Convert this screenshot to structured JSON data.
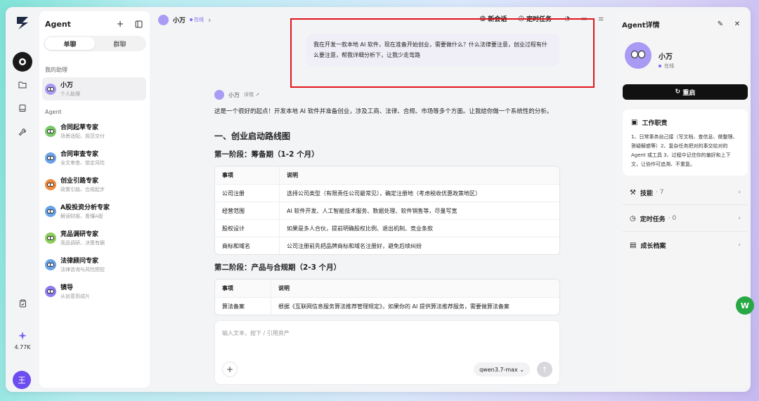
{
  "rail": {
    "stat_value": "4.77K",
    "user_initial": "王"
  },
  "sidebar": {
    "title": "Agent",
    "tabs": [
      "单聊",
      "群聊"
    ],
    "section_my": "我的助理",
    "my_assistant": {
      "name": "小万",
      "sub": "个人助理"
    },
    "section_agent": "Agent",
    "agents": [
      {
        "name": "合同起草专家",
        "sub": "场景适配、规范交付",
        "color": "#7ac96b"
      },
      {
        "name": "合同审查专家",
        "sub": "全文审查、锁定风险",
        "color": "#6aa3e8"
      },
      {
        "name": "创业引路专家",
        "sub": "政策引路、合规起步",
        "color": "#f08a3c"
      },
      {
        "name": "A股投资分析专家",
        "sub": "解读财报、看懂A股",
        "color": "#6aa3e8"
      },
      {
        "name": "竞品调研专家",
        "sub": "竞品调研、决策有据",
        "color": "#8ccf5e"
      },
      {
        "name": "法律顾问专家",
        "sub": "法律咨询与风险把控",
        "color": "#6aa3e8"
      },
      {
        "name": "镜导",
        "sub": "从创意到成片",
        "color": "#8e7cf0"
      }
    ]
  },
  "topbar": {
    "name": "小万",
    "status": "在线",
    "new_chat": "新会话",
    "scheduled": "定时任务"
  },
  "chat": {
    "user_message": "我在开发一款本地 AI 软件，现在准备开始创业，需要做什么？什么法律要注意，创业过程有什么要注意，帮我详细分析下，让我少走弯路",
    "reply_name": "小万",
    "reply_detail": "详情",
    "intro": "这是一个很好的起点！开发本地 AI 软件并准备创业，涉及工商、法律、合规、市场等多个方面。让我给你做一个系统性的分析。",
    "h1": "一、创业启动路线图",
    "phase1_title": "第一阶段：筹备期（1-2 个月）",
    "table1": {
      "headers": [
        "事项",
        "说明"
      ],
      "rows": [
        [
          "公司注册",
          "选择公司类型（有限责任公司最常见），确定注册地（考虑税收优惠政策地区）"
        ],
        [
          "经营范围",
          "AI 软件开发、人工智能技术服务、数据处理、软件销售等，尽量写宽"
        ],
        [
          "股权设计",
          "如果是多人合伙，提前明确股权比例、退出机制、竞业条款"
        ],
        [
          "商标和域名",
          "公司注册前先把品牌商标和域名注册好，避免后续纠纷"
        ]
      ]
    },
    "phase2_title": "第二阶段：产品与合规期（2-3 个月）",
    "table2": {
      "headers": [
        "事项",
        "说明"
      ],
      "rows": [
        [
          "算法备案",
          "根据《互联网信息服务算法推荐管理规定》，如果你的 AI 提供算法推荐服务，需要做算法备案"
        ]
      ]
    }
  },
  "composer": {
    "placeholder": "输入文本，按下 / 引用资产",
    "model": "qwen3.7-max"
  },
  "panel": {
    "title": "Agent详情",
    "name": "小万",
    "status": "在线",
    "reset": "重启",
    "duty_title": "工作职责",
    "duty_body": "1、日常事务自己接（写文档、查信息、做整理、答疑解惑等）2、复杂任务把对的事交给对的 Agent 或工具 3、过程中记住你的偏好和上下文，让协作可追溯、不重复。",
    "rows": [
      {
        "label": "技能",
        "count": "· 7"
      },
      {
        "label": "定时任务",
        "count": "· 0"
      },
      {
        "label": "成长档案",
        "count": ""
      }
    ]
  },
  "float_badge": "W"
}
